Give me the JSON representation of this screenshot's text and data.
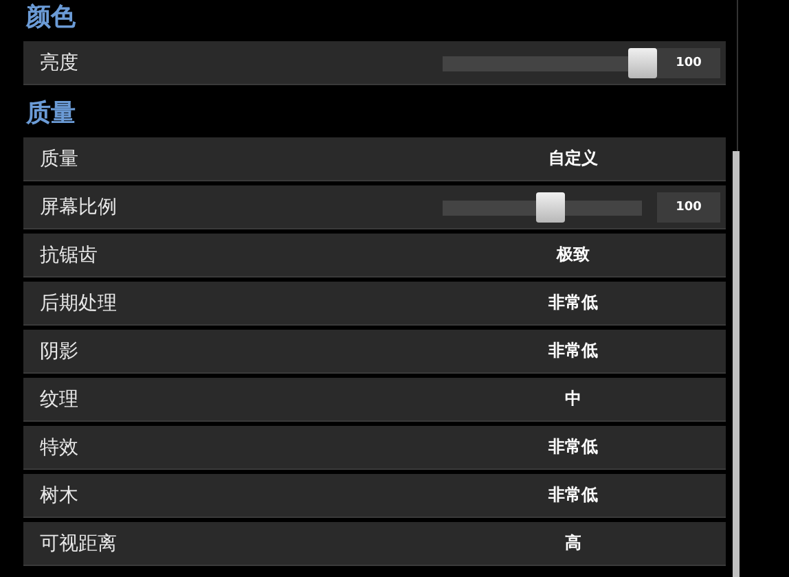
{
  "sections": [
    {
      "title": "颜色",
      "rows": [
        {
          "kind": "slider",
          "label": "亮度",
          "level": 1.0,
          "reading": "100"
        }
      ]
    },
    {
      "title": "质量",
      "rows": [
        {
          "kind": "select",
          "label": "质量",
          "value": "自定义"
        },
        {
          "kind": "slider",
          "label": "屏幕比例",
          "level": 0.55,
          "reading": "100"
        },
        {
          "kind": "select",
          "label": "抗锯齿",
          "value": "极致"
        },
        {
          "kind": "select",
          "label": "后期处理",
          "value": "非常低"
        },
        {
          "kind": "select",
          "label": "阴影",
          "value": "非常低"
        },
        {
          "kind": "select",
          "label": "纹理",
          "value": "中"
        },
        {
          "kind": "select",
          "label": "特效",
          "value": "非常低"
        },
        {
          "kind": "select",
          "label": "树木",
          "value": "非常低"
        },
        {
          "kind": "select",
          "label": "可视距离",
          "value": "高"
        }
      ]
    }
  ]
}
